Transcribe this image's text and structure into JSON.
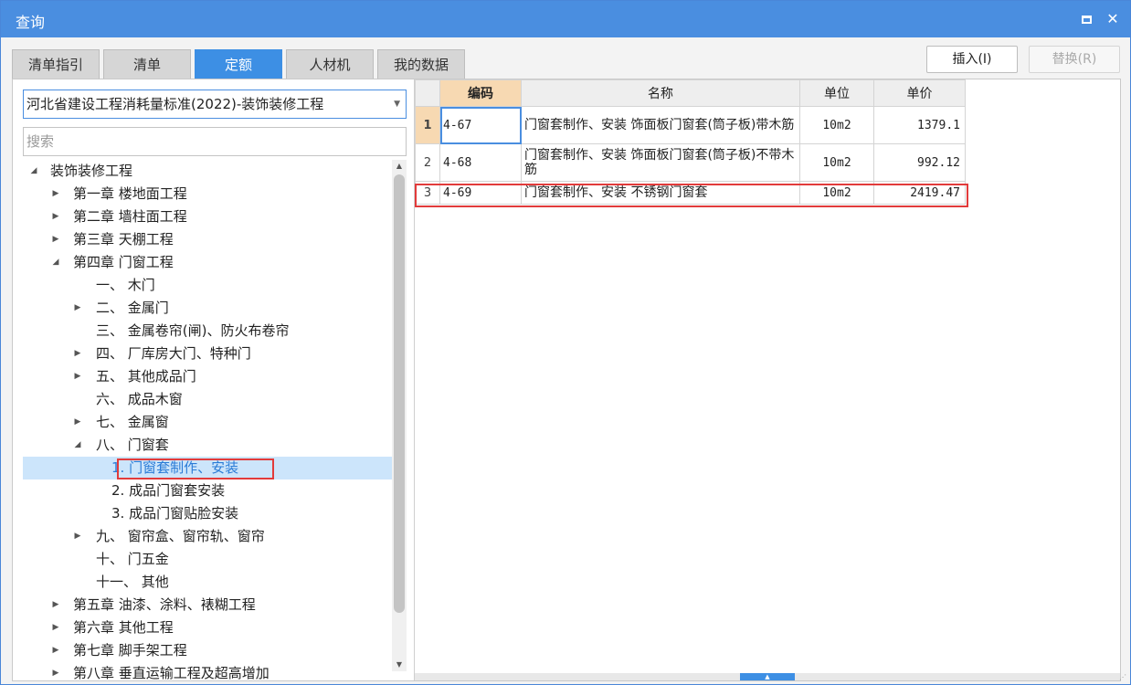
{
  "window": {
    "title": "查询",
    "maximize_icon": "maximize-icon",
    "close_label": "✕"
  },
  "tabs": [
    {
      "label": "清单指引",
      "active": false
    },
    {
      "label": "清单",
      "active": false
    },
    {
      "label": "定额",
      "active": true
    },
    {
      "label": "人材机",
      "active": false
    },
    {
      "label": "我的数据",
      "active": false
    }
  ],
  "actions": {
    "insert_label": "插入(I)",
    "replace_label": "替换(R)",
    "replace_disabled": true
  },
  "left": {
    "standard_selected": "河北省建设工程消耗量标准(2022)-装饰装修工程",
    "search_placeholder": "搜索",
    "search_value": ""
  },
  "tree": [
    {
      "label": "装饰装修工程",
      "expanded": true,
      "caret": "expanded"
    },
    {
      "label": "第一章 楼地面工程",
      "caret": "collapsed"
    },
    {
      "label": "第二章 墙柱面工程",
      "caret": "collapsed"
    },
    {
      "label": "第三章 天棚工程",
      "caret": "collapsed"
    },
    {
      "label": "第四章 门窗工程",
      "caret": "expanded"
    },
    {
      "label": "一、 木门",
      "caret": "none"
    },
    {
      "label": "二、 金属门",
      "caret": "collapsed"
    },
    {
      "label": "三、 金属卷帘(闸)、防火布卷帘",
      "caret": "none"
    },
    {
      "label": "四、 厂库房大门、特种门",
      "caret": "collapsed"
    },
    {
      "label": "五、 其他成品门",
      "caret": "collapsed"
    },
    {
      "label": "六、 成品木窗",
      "caret": "none"
    },
    {
      "label": "七、 金属窗",
      "caret": "collapsed"
    },
    {
      "label": "八、 门窗套",
      "caret": "expanded"
    },
    {
      "label": "1. 门窗套制作、安装",
      "caret": "none",
      "selected": true
    },
    {
      "label": "2. 成品门窗套安装",
      "caret": "none"
    },
    {
      "label": "3. 成品门窗贴脸安装",
      "caret": "none"
    },
    {
      "label": "九、 窗帘盒、窗帘轨、窗帘",
      "caret": "collapsed"
    },
    {
      "label": "十、 门五金",
      "caret": "none"
    },
    {
      "label": "十一、 其他",
      "caret": "none"
    },
    {
      "label": "第五章 油漆、涂料、裱糊工程",
      "caret": "collapsed"
    },
    {
      "label": "第六章 其他工程",
      "caret": "collapsed"
    },
    {
      "label": "第七章 脚手架工程",
      "caret": "collapsed"
    },
    {
      "label": "第八章 垂直运输工程及超高增加",
      "caret": "collapsed"
    }
  ],
  "grid": {
    "columns": [
      "",
      "编码",
      "名称",
      "单位",
      "单价"
    ],
    "rows": [
      {
        "no": "1",
        "code": "4-67",
        "name": "门窗套制作、安装 饰面板门窗套(筒子板)带木筋",
        "unit": "10m2",
        "price": "1379.1"
      },
      {
        "no": "2",
        "code": "4-68",
        "name": "门窗套制作、安装 饰面板门窗套(筒子板)不带木筋",
        "unit": "10m2",
        "price": "992.12"
      },
      {
        "no": "3",
        "code": "4-69",
        "name": "门窗套制作、安装 不锈钢门窗套",
        "unit": "10m2",
        "price": "2419.47"
      }
    ]
  },
  "colors": {
    "titlebar": "#4a8ee0",
    "active_tab": "#3d8fe4",
    "highlight_border": "#e23b3b",
    "selected_tree_bg": "#cce5fb",
    "code_header_bg": "#f7d9b2"
  }
}
